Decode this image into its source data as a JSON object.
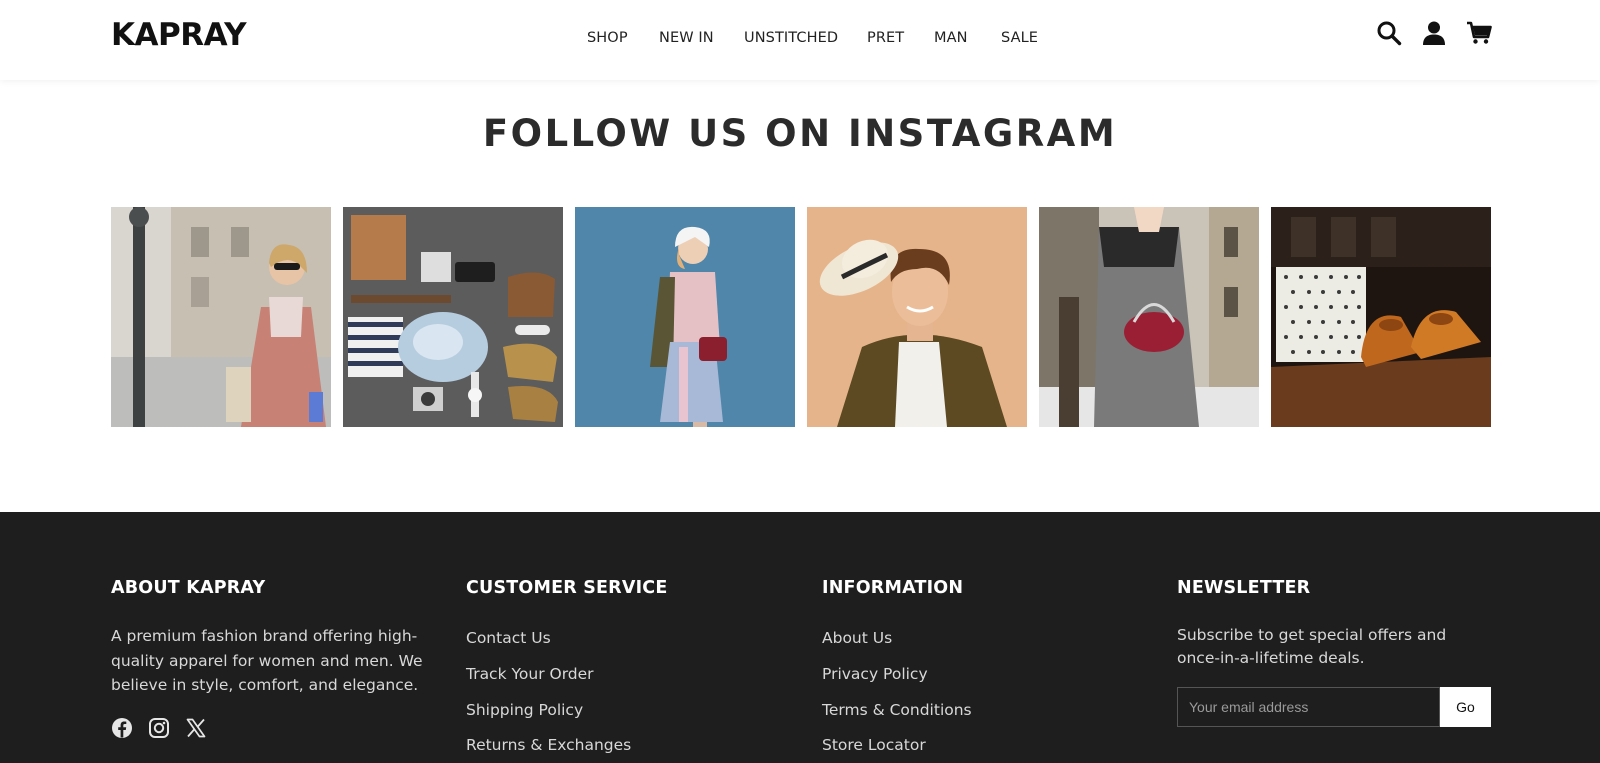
{
  "header": {
    "logo": "KAPRAY",
    "nav": [
      "SHOP",
      "NEW IN",
      "UNSTITCHED",
      "PRET",
      "MAN",
      "SALE"
    ],
    "icons": [
      "search-icon",
      "user-icon",
      "cart-icon"
    ]
  },
  "instagram": {
    "title": "FOLLOW US ON INSTAGRAM"
  },
  "footer": {
    "about": {
      "title": "ABOUT KAPRAY",
      "text": "A premium fashion brand offering high-quality apparel for women and men. We believe in style, comfort, and elegance.",
      "social_icons": [
        "facebook-icon",
        "instagram-icon",
        "x-icon"
      ]
    },
    "customer_service": {
      "title": "CUSTOMER SERVICE",
      "links": [
        "Contact Us",
        "Track Your Order",
        "Shipping Policy",
        "Returns & Exchanges"
      ]
    },
    "information": {
      "title": "INFORMATION",
      "links": [
        "About Us",
        "Privacy Policy",
        "Terms & Conditions",
        "Store Locator"
      ]
    },
    "newsletter": {
      "title": "NEWSLETTER",
      "text": "Subscribe to get special offers and once-in-a-lifetime deals.",
      "placeholder": "Your email address",
      "button": "Go"
    }
  },
  "colors": {
    "footer_bg": "#1e1e1e",
    "text_dark": "#222222",
    "footer_text": "#d8d8d8"
  }
}
